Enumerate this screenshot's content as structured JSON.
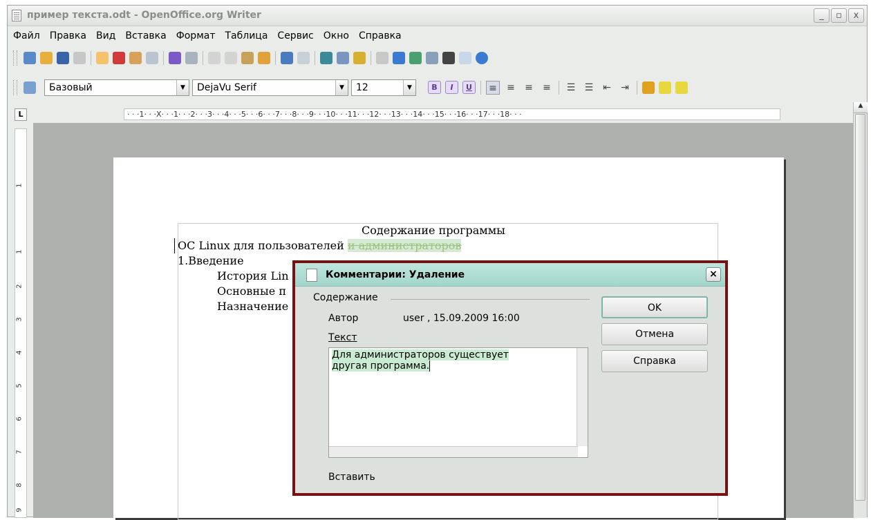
{
  "window": {
    "title": "пример текста.odt - OpenOffice.org Writer",
    "controls": [
      "_",
      "▫",
      "x"
    ]
  },
  "menu": [
    "Файл",
    "Правка",
    "Вид",
    "Вставка",
    "Формат",
    "Таблица",
    "Сервис",
    "Окно",
    "Справка"
  ],
  "format_toolbar": {
    "style": "Базовый",
    "font": "DejaVu Serif",
    "size": "12"
  },
  "ruler": {
    "corner": "L",
    "ticks": "· · ·1· · ·X· · ·1· · ·2· · ·3· · ·4· · ·5· · ·6· · ·7· · ·8· · ·9· · ·10· · ·11· · ·12· · ·13· · ·14· · ·15· · ·16· · ·17· · ·18· · ·",
    "vertical": [
      "1",
      "1",
      "2",
      "3",
      "4",
      "5",
      "6",
      "7",
      "8",
      "9"
    ]
  },
  "document": {
    "heading": "Содержание программы",
    "line1_kept": "ОС Linux для пользователей",
    "line1_deleted": "и администраторов",
    "line2": "1.Введение",
    "line3": "История Lin",
    "line4": "Основные п",
    "line5": "Назначение"
  },
  "dialog": {
    "title": "Комментарии: Удаление",
    "close": "×",
    "group_label": "Содержание",
    "author_label": "Автор",
    "author_value": "user , 15.09.2009 16:00",
    "text_label": "Текст",
    "text_line1": "Для администраторов существует",
    "text_line2": "другая программа.",
    "insert_label": "Вставить",
    "ok": "OK",
    "cancel": "Отмена",
    "help": "Справка"
  }
}
